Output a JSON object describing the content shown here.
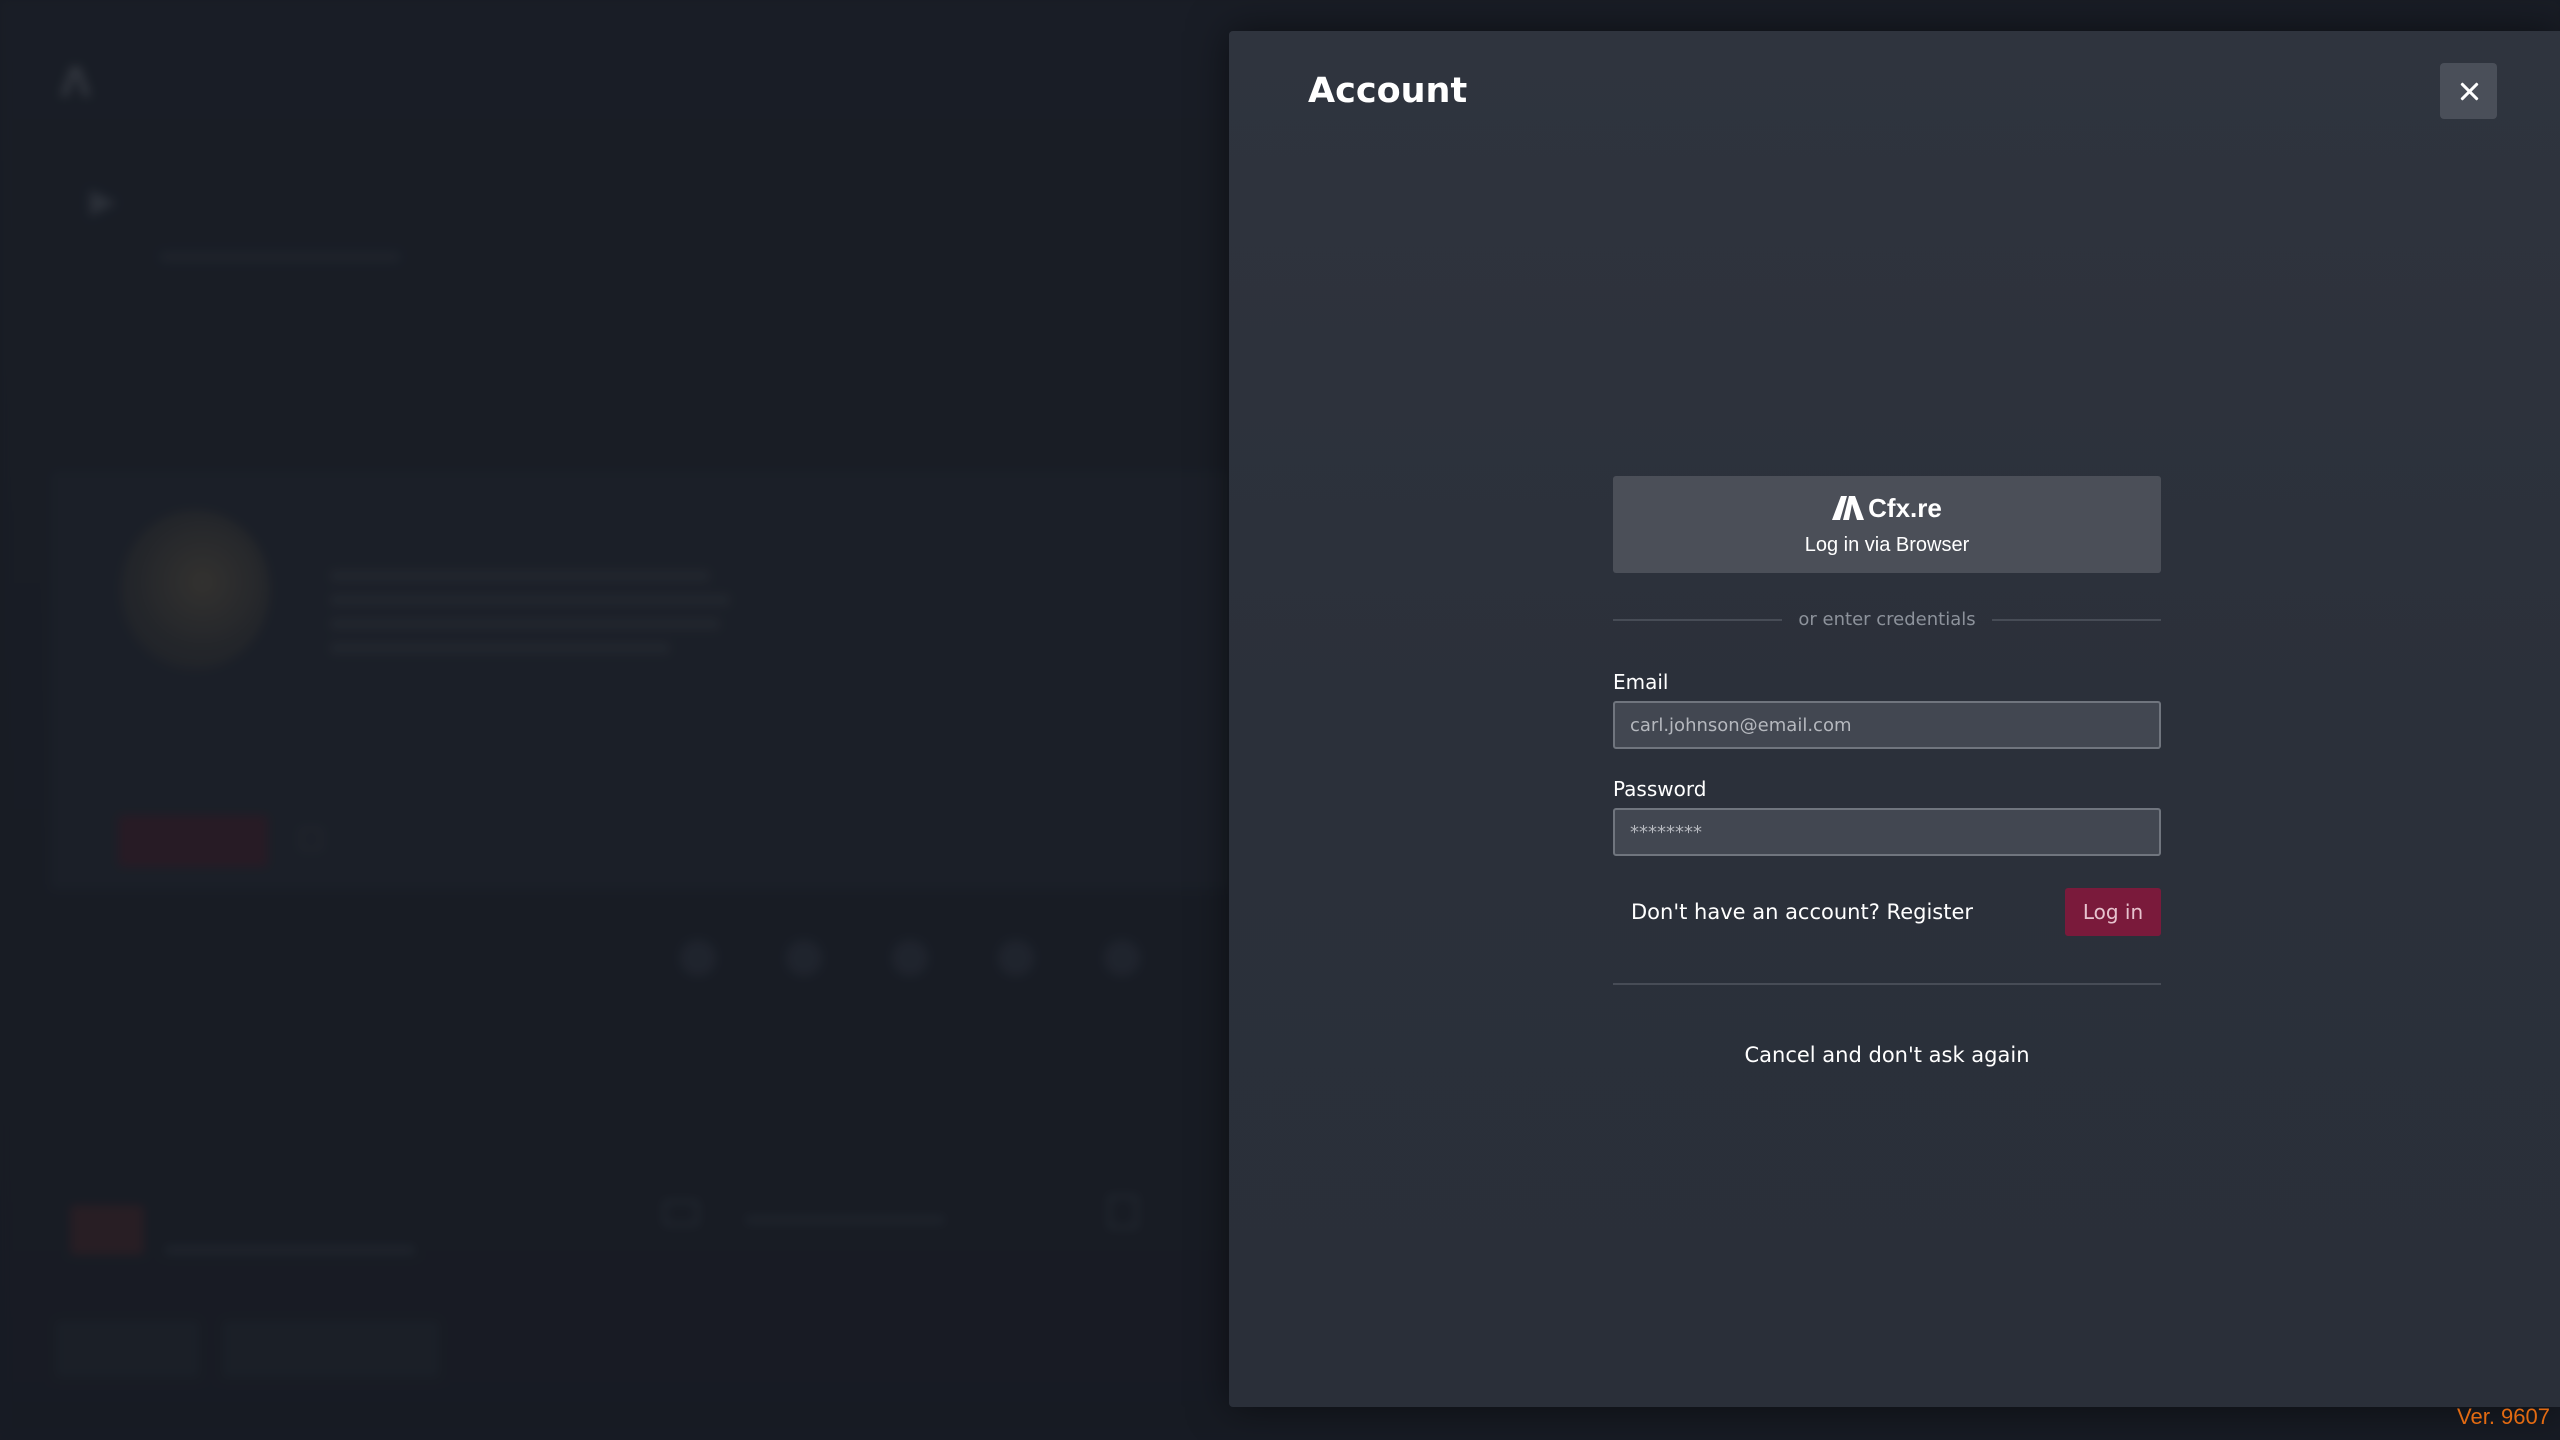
{
  "modal": {
    "title": "Account",
    "close_icon": "close-icon"
  },
  "form": {
    "browser_brand": "Cfx.re",
    "browser_label": "Log in via Browser",
    "divider_text": "or enter credentials",
    "email_label": "Email",
    "email_placeholder": "carl.johnson@email.com",
    "password_label": "Password",
    "password_placeholder": "********",
    "register_text": "Don't have an account? Register",
    "login_label": "Log in",
    "cancel_text": "Cancel and don't ask again"
  },
  "version": "Ver. 9607",
  "colors": {
    "accent": "#7a1a3b",
    "version": "#e26a12",
    "modal_bg": "#2f343e"
  }
}
